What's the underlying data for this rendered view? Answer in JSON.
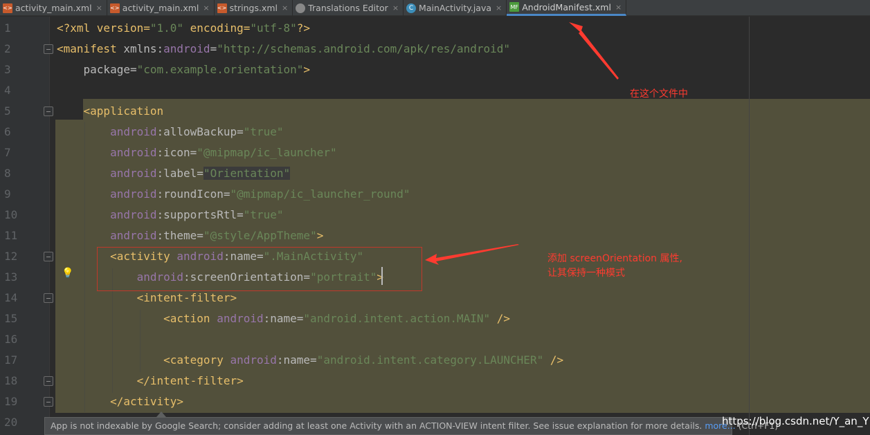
{
  "tabs": [
    {
      "label": "activity_main.xml",
      "icon": "xml-file-icon",
      "active": false
    },
    {
      "label": "activity_main.xml",
      "icon": "xml-file-icon",
      "active": false
    },
    {
      "label": "strings.xml",
      "icon": "xml-file-icon",
      "active": false
    },
    {
      "label": "Translations Editor",
      "icon": "globe-icon",
      "active": false
    },
    {
      "label": "MainActivity.java",
      "icon": "java-class-icon",
      "active": false
    },
    {
      "label": "AndroidManifest.xml",
      "icon": "manifest-icon",
      "active": true
    }
  ],
  "close_glyph": "×",
  "code_lines": [
    [
      [
        "pi",
        "<?xml version="
      ],
      [
        "val",
        "\"1.0\""
      ],
      [
        "pi",
        " encoding="
      ],
      [
        "val",
        "\"utf-8\""
      ],
      [
        "pi",
        "?>"
      ]
    ],
    [
      [
        "tag",
        "<manifest "
      ],
      [
        "attr",
        "xmlns:"
      ],
      [
        "ns",
        "android"
      ],
      [
        "attr",
        "="
      ],
      [
        "val",
        "\"http://schemas.android.com/apk/res/android\""
      ]
    ],
    [
      [
        "attr",
        "    package="
      ],
      [
        "val",
        "\"com.example.orientation\""
      ],
      [
        "tag",
        ">"
      ]
    ],
    [],
    [
      [
        "tag",
        "    <application"
      ]
    ],
    [
      [
        "ns",
        "        android"
      ],
      [
        "attr",
        ":allowBackup="
      ],
      [
        "val",
        "\"true\""
      ]
    ],
    [
      [
        "ns",
        "        android"
      ],
      [
        "attr",
        ":icon="
      ],
      [
        "val",
        "\"@mipmap/ic_launcher\""
      ]
    ],
    [
      [
        "ns",
        "        android"
      ],
      [
        "attr",
        ":label="
      ],
      [
        "val sel",
        "\"Orientation\""
      ]
    ],
    [
      [
        "ns",
        "        android"
      ],
      [
        "attr",
        ":roundIcon="
      ],
      [
        "val",
        "\"@mipmap/ic_launcher_round\""
      ]
    ],
    [
      [
        "ns",
        "        android"
      ],
      [
        "attr",
        ":supportsRtl="
      ],
      [
        "val",
        "\"true\""
      ]
    ],
    [
      [
        "ns",
        "        android"
      ],
      [
        "attr",
        ":theme="
      ],
      [
        "val",
        "\"@style/AppTheme\""
      ],
      [
        "tag",
        ">"
      ]
    ],
    [
      [
        "tag",
        "        <activity "
      ],
      [
        "ns",
        "android"
      ],
      [
        "attr",
        ":name="
      ],
      [
        "val",
        "\".MainActivity\""
      ]
    ],
    [
      [
        "ns",
        "            android"
      ],
      [
        "attr",
        ":screenOrientation="
      ],
      [
        "val",
        "\"portrait\""
      ],
      [
        "tag",
        ">"
      ]
    ],
    [
      [
        "tag",
        "            <intent-filter>"
      ]
    ],
    [
      [
        "tag",
        "                <action "
      ],
      [
        "ns",
        "android"
      ],
      [
        "attr",
        ":name="
      ],
      [
        "val",
        "\"android.intent.action.MAIN\""
      ],
      [
        "tag",
        " />"
      ]
    ],
    [],
    [
      [
        "tag",
        "                <category "
      ],
      [
        "ns",
        "android"
      ],
      [
        "attr",
        ":name="
      ],
      [
        "val",
        "\"android.intent.category.LAUNCHER\""
      ],
      [
        "tag",
        " />"
      ]
    ],
    [
      [
        "tag",
        "            </intent-filter>"
      ]
    ],
    [
      [
        "tag",
        "        </activity>"
      ]
    ],
    []
  ],
  "annotations": {
    "file_note": "在这个文件中",
    "attr_note_line1": "添加 screenOrientation 属性,",
    "attr_note_line2": "让其保持一种模式"
  },
  "tooltip": {
    "message": "App is not indexable by Google Search; consider adding at least one Activity with an ACTION-VIEW intent filter. See issue explanation for more details. ",
    "more_link": "more...",
    "shortcut": " (Ctrl+F1)"
  },
  "watermark": "https://blog.csdn.net/Y_an_Y",
  "colors": {
    "tag": "#e8bf6a",
    "namespace": "#9876aa",
    "value": "#6a8759",
    "highlight": "#52503b",
    "annotation": "#ff3b30",
    "active_tab": "#4a88c7"
  }
}
